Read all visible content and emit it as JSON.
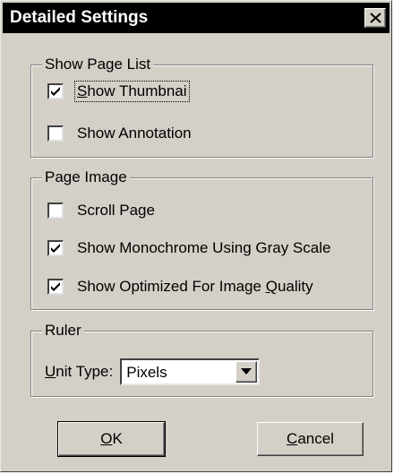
{
  "window": {
    "title": "Detailed Settings",
    "close_icon": "close-x-icon"
  },
  "show_page_list": {
    "legend": "Show Page List",
    "options": [
      {
        "label_pre": "",
        "label_key": "S",
        "label_post": "how Thumbnai",
        "checked": true
      },
      {
        "label_pre": "Show Annotation",
        "label_key": "",
        "label_post": "",
        "checked": false
      }
    ]
  },
  "page_image": {
    "legend": "Page Image",
    "options": [
      {
        "label_pre": "Scroll Page",
        "label_key": "",
        "label_post": "",
        "checked": false
      },
      {
        "label_pre": "Show Monochrome Using Gray Scale",
        "label_key": "",
        "label_post": "",
        "checked": true
      },
      {
        "label_pre": "Show Optimized For Image ",
        "label_key": "Q",
        "label_post": "uality",
        "checked": true
      }
    ]
  },
  "ruler": {
    "legend": "Ruler",
    "unit_label_key": "U",
    "unit_label_rest": "nit Type:",
    "unit_value": "Pixels"
  },
  "buttons": {
    "ok_key": "O",
    "ok_rest": "K",
    "cancel_key": "C",
    "cancel_rest": "ancel"
  },
  "colors": {
    "dialog_bg": "#d4d0c8",
    "titlebar_bg": "#000000",
    "title_fg": "#ffffff"
  }
}
